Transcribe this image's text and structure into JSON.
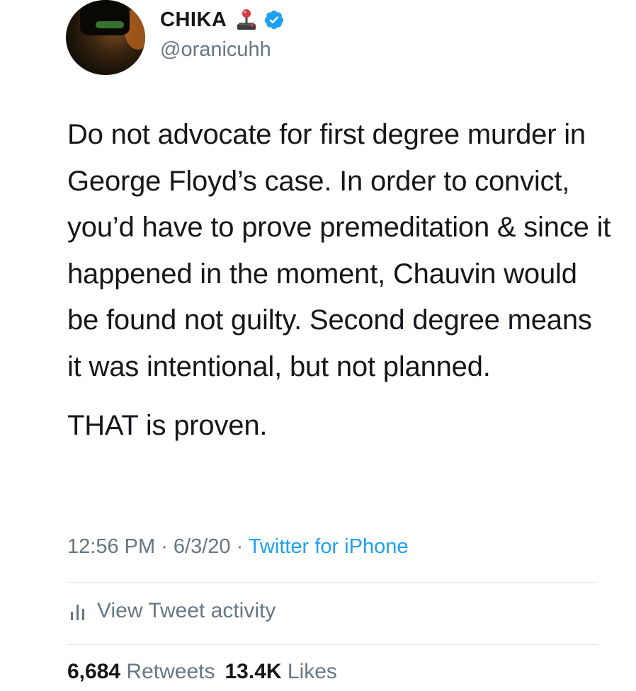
{
  "author": {
    "display_name": "CHIKA",
    "handle": "@oranicuhh",
    "name_emoji": "joystick-icon",
    "verified": true,
    "verified_color": "#1da1f2"
  },
  "tweet": {
    "paragraphs": [
      "Do not advocate for first degree murder in George Floyd’s case. In order to convict, you’d have to prove premeditation & since it happened in the moment, Chauvin would be found not guilty. Second degree means it was intentional, but not planned.",
      "THAT is proven."
    ],
    "time": "12:56 PM",
    "separator_1": " · ",
    "date": "6/3/20",
    "separator_2": " · ",
    "source": "Twitter for iPhone"
  },
  "activity": {
    "icon": "analytics-bars-icon",
    "label": "View Tweet activity"
  },
  "stats": {
    "retweets_count": "6,684",
    "retweets_label": "Retweets",
    "likes_count": "13.4K",
    "likes_label": "Likes"
  },
  "colors": {
    "text_primary": "#14171a",
    "text_secondary": "#657786",
    "link": "#1da1f2",
    "divider": "#e1e8ed"
  }
}
